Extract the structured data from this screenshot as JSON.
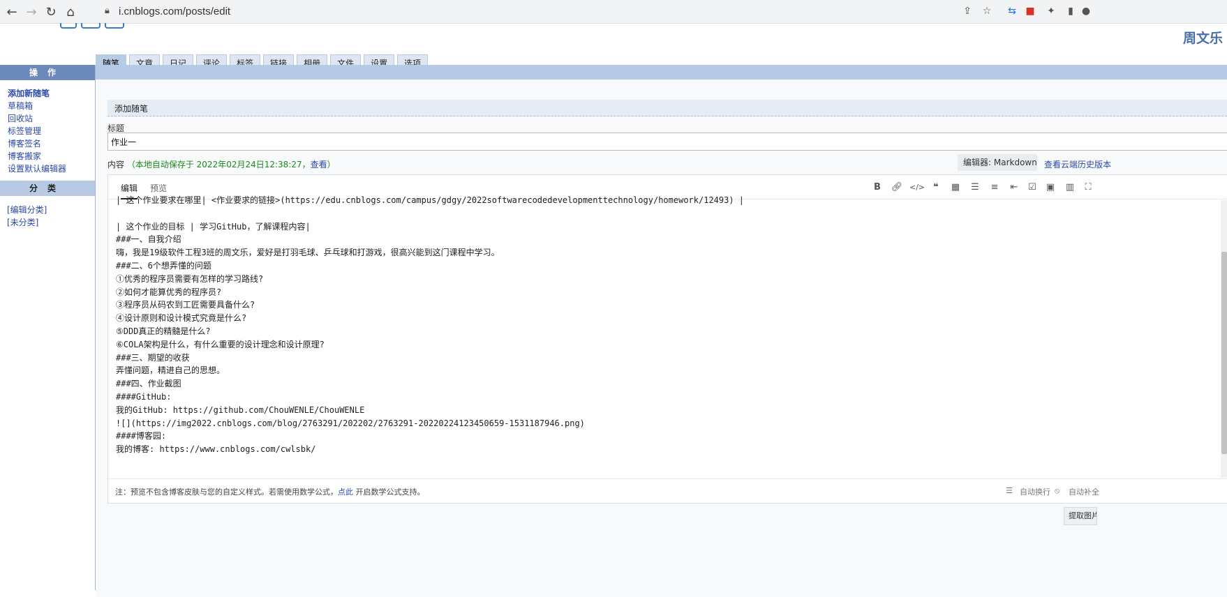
{
  "browser": {
    "url": "i.cnblogs.com/posts/edit"
  },
  "header": {
    "blog_name": "周文乐"
  },
  "tabs": [
    {
      "label": "随笔",
      "active": true
    },
    {
      "label": "文章"
    },
    {
      "label": "日记"
    },
    {
      "label": "评论"
    },
    {
      "label": "标签"
    },
    {
      "label": "链接"
    },
    {
      "label": "相册"
    },
    {
      "label": "文件"
    },
    {
      "label": "设置"
    },
    {
      "label": "选项"
    }
  ],
  "sidebar": {
    "ops_title": "操作",
    "ops": [
      "添加新随笔",
      "草稿箱",
      "回收站",
      "标签管理",
      "博客签名",
      "博客搬家",
      "设置默认编辑器"
    ],
    "cat_title": "分类",
    "cats": [
      "[编辑分类]",
      "[未分类]"
    ]
  },
  "form": {
    "section_title": "添加随笔",
    "title_label": "标题",
    "title_value": "作业一",
    "content_label": "内容",
    "autosave_text": "（本地自动保存于 2022年02月24日12:38:27，",
    "autosave_link": "查看",
    "autosave_close": "）",
    "editor_select": "编辑器: Markdown",
    "cloud_history": "查看云端历史版本"
  },
  "editor": {
    "tab_edit": "编辑",
    "tab_preview": "预览",
    "lines": [
      "| 这个作业要求在哪里| <作业要求的链接>(https://edu.cnblogs.com/campus/gdgy/2022softwarecodedevelopmenttechnology/homework/12493) |",
      "",
      "| 这个作业的目标 | 学习GitHub，了解课程内容|",
      "###一、自我介绍",
      "嗨，我是19级软件工程3班的周文乐，爱好是打羽毛球、乒乓球和打游戏，很高兴能到这门课程中学习。",
      "###二、6个想弄懂的问题",
      "①优秀的程序员需要有怎样的学习路线?",
      "②如何才能算优秀的程序员?",
      "③程序员从码农到工匠需要具备什么?",
      "④设计原则和设计模式究竟是什么?",
      "⑤DDD真正的精髓是什么?",
      "⑥COLA架构是什么，有什么重要的设计理念和设计原理?",
      "###三、期望的收获",
      "弄懂问题，精进自己的思想。",
      "###四、作业截图",
      "####GitHub:",
      "我的GitHub: https://github.com/ChouWENLE/ChouWENLE",
      "![](https://img2022.cnblogs.com/blog/2763291/202202/2763291-20220224123450659-1531187946.png)",
      "####博客园:",
      "我的博客: https://www.cnblogs.com/cwlsbk/"
    ],
    "note_prefix": "注：预览不包含博客皮肤与您的自定义样式。若需使用数学公式，",
    "note_link": "点此",
    "note_suffix": " 开启数学公式支持。",
    "wrap_label": "自动换行",
    "autocomplete_label": "自动补全",
    "extract_button": "提取图片"
  }
}
